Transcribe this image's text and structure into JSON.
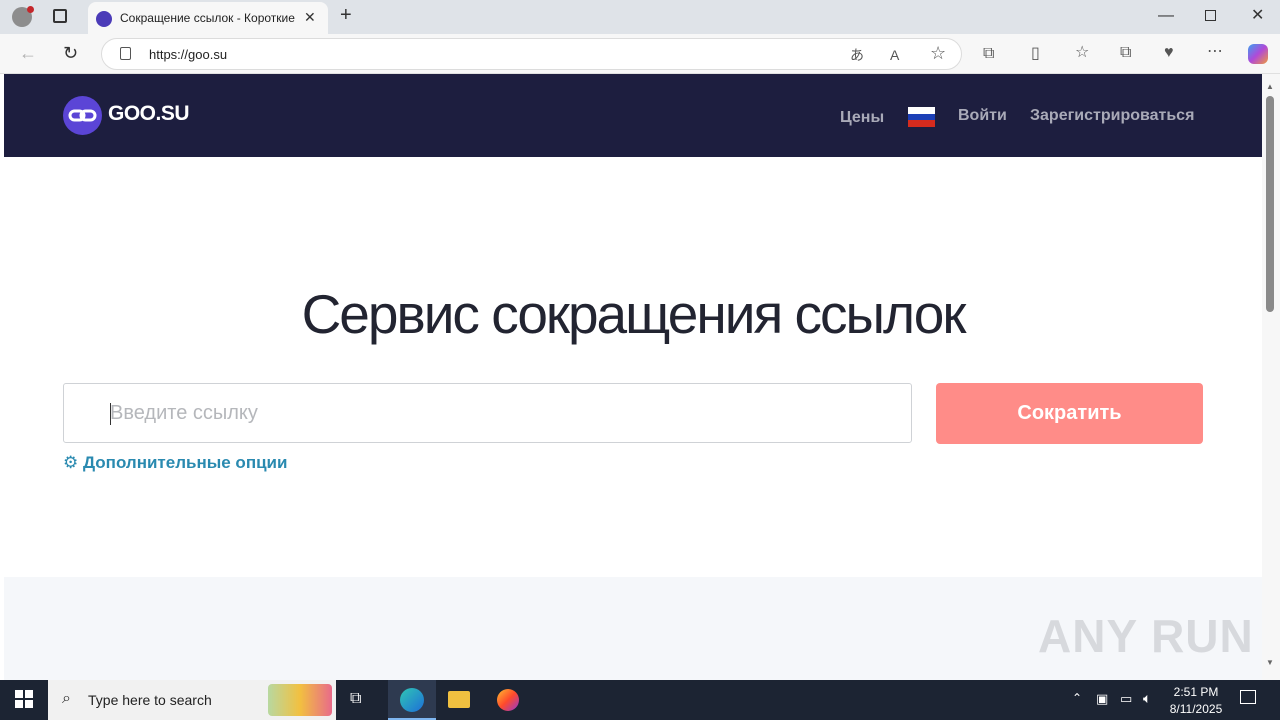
{
  "browser": {
    "tab_title": "Сокращение ссылок - Короткие",
    "url": "https://goo.su"
  },
  "site": {
    "logo_text": "GOO.SU",
    "nav": {
      "prices": "Цены",
      "login": "Войти",
      "register": "Зарегистрироваться"
    },
    "hero_title": "Сервис сокращения ссылок",
    "input_placeholder": "Введите ссылку",
    "shorten_button": "Сократить",
    "options_link": "Дополнительные опции",
    "watermark": "ANY RUN"
  },
  "taskbar": {
    "search_placeholder": "Type here to search",
    "time": "2:51 PM",
    "date": "8/11/2025"
  },
  "colors": {
    "navbar": "#1d1e3f",
    "button": "#ff8c88",
    "link": "#2a8ab0"
  }
}
